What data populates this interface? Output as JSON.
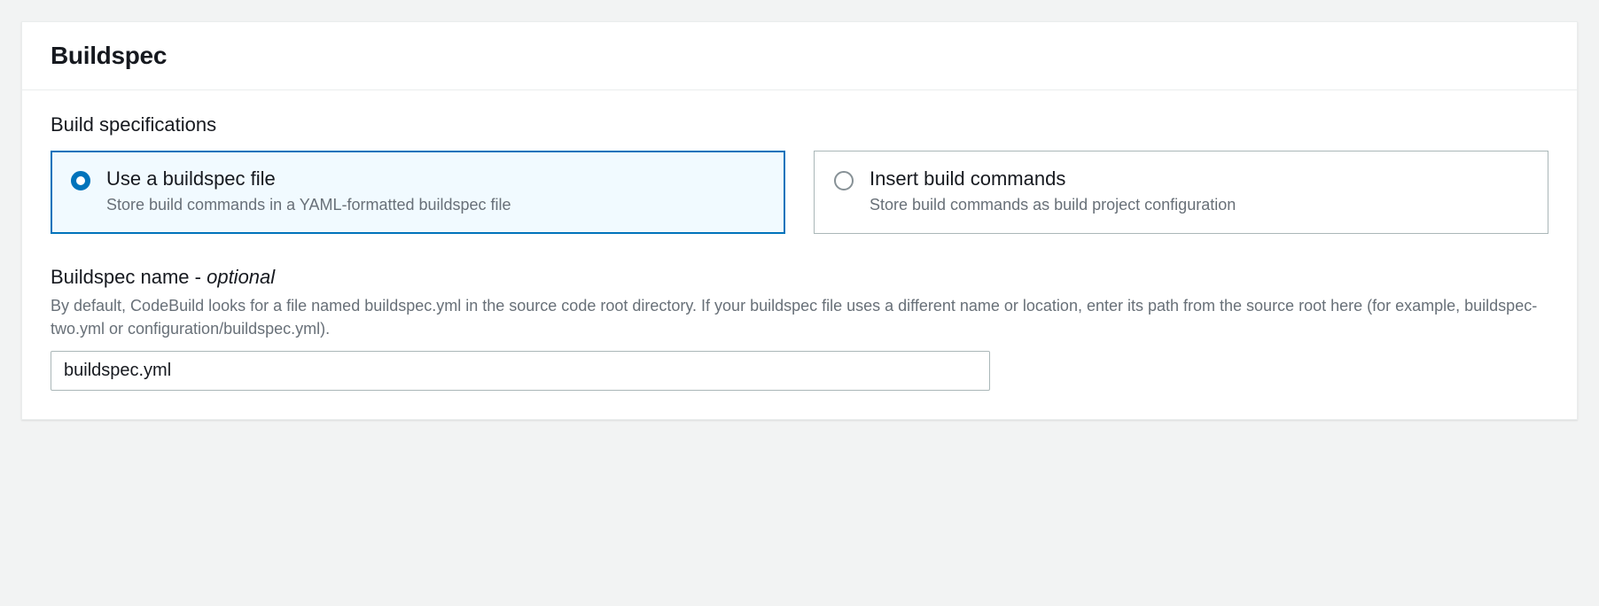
{
  "panel": {
    "title": "Buildspec"
  },
  "buildSpecifications": {
    "sectionLabel": "Build specifications",
    "options": [
      {
        "title": "Use a buildspec file",
        "description": "Store build commands in a YAML-formatted buildspec file",
        "selected": true
      },
      {
        "title": "Insert build commands",
        "description": "Store build commands as build project configuration",
        "selected": false
      }
    ]
  },
  "buildspecName": {
    "labelPrefix": "Buildspec name - ",
    "labelOptional": "optional",
    "help": "By default, CodeBuild looks for a file named buildspec.yml in the source code root directory. If your buildspec file uses a different name or location, enter its path from the source root here (for example, buildspec-two.yml or configuration/buildspec.yml).",
    "value": "buildspec.yml"
  }
}
